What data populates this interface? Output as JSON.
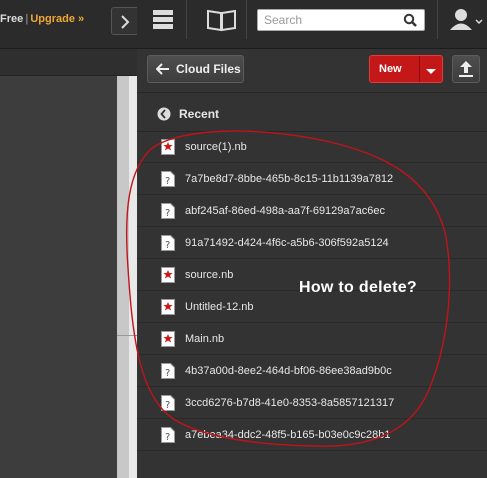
{
  "plan": {
    "status": "Free",
    "separator": "|",
    "upgrade": "Upgrade »"
  },
  "search": {
    "placeholder": "Search"
  },
  "toolbar": {
    "back_label": "Cloud Files",
    "new_label": "New"
  },
  "section": {
    "title": "Recent"
  },
  "files": [
    {
      "name": "source(1).nb",
      "icon": "notebook-icon"
    },
    {
      "name": "7a7be8d7-8bbe-465b-8c15-11b1139a7812",
      "icon": "unknown-file-icon"
    },
    {
      "name": "abf245af-86ed-498a-aa7f-69129a7ac6ec",
      "icon": "unknown-file-icon"
    },
    {
      "name": "91a71492-d424-4f6c-a5b6-306f592a5124",
      "icon": "unknown-file-icon"
    },
    {
      "name": "source.nb",
      "icon": "notebook-icon"
    },
    {
      "name": "Untitled-12.nb",
      "icon": "notebook-icon"
    },
    {
      "name": "Main.nb",
      "icon": "notebook-icon"
    },
    {
      "name": "4b37a00d-8ee2-464d-bf06-86ee38ad9b0c",
      "icon": "unknown-file-icon"
    },
    {
      "name": "3ccd6276-b7d8-41e0-8353-8a5857121317",
      "icon": "unknown-file-icon"
    },
    {
      "name": "a7ebea34-ddc2-48f5-b165-b03e0c9c28b1",
      "icon": "unknown-file-icon"
    }
  ],
  "annotation": {
    "text": "How to delete?",
    "color": "#c0141a"
  },
  "colors": {
    "accent_red": "#c41818",
    "upgrade_orange": "#f0a830",
    "panel_bg": "#333333"
  }
}
